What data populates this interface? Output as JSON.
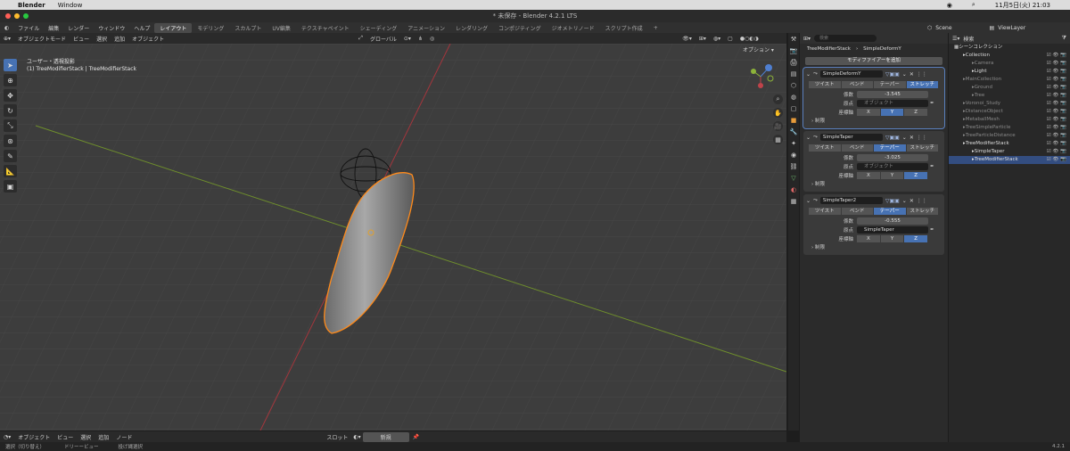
{
  "mac": {
    "apple": "",
    "app": "Blender",
    "menu": "Window",
    "datetime": "11月5日(火) 21:03"
  },
  "window": {
    "title": "* 未保存 - Blender 4.2.1 LTS"
  },
  "menubar": {
    "items": [
      "ファイル",
      "編集",
      "レンダー",
      "ウィンドウ",
      "ヘルプ"
    ],
    "workspaces": [
      "レイアウト",
      "モデリング",
      "スカルプト",
      "UV編集",
      "テクスチャペイント",
      "シェーディング",
      "アニメーション",
      "レンダリング",
      "コンポジティング",
      "ジオメトリノード",
      "スクリプト作成"
    ],
    "scene": "Scene",
    "viewlayer": "ViewLayer"
  },
  "viewport_header": {
    "mode": "オブジェクトモード",
    "items": [
      "ビュー",
      "選択",
      "追加",
      "オブジェクト"
    ],
    "orientation": "グローバル",
    "options": "オプション"
  },
  "viewport": {
    "overlay_line1": "ユーザー・透視投影",
    "overlay_line2": "(1) TreeModifierStack | TreeModifierStack"
  },
  "viewport_footer": {
    "mode": "オブジェクト",
    "items": [
      "ビュー",
      "選択",
      "追加",
      "ノード"
    ],
    "slot": "スロット",
    "new": "新規"
  },
  "statusbar": {
    "items": [
      "選択（切り替え）",
      "ドリーービュー",
      "投げ縄選択"
    ],
    "version": "4.2.1"
  },
  "properties": {
    "search_placeholder": "検索",
    "crumb_object": "TreeModifierStack",
    "crumb_modifier": "SimpleDeformY",
    "add_modifier": "モディファイアーを追加",
    "modes": [
      "ツイスト",
      "ベンド",
      "テーパー",
      "ストレッチ"
    ],
    "labels": {
      "factor": "係数",
      "origin": "原点",
      "axis": "座標軸",
      "limit": "制限",
      "object_placeholder": "オブジェクト"
    },
    "axes": [
      "X",
      "Y",
      "Z"
    ],
    "modifiers": [
      {
        "name": "SimpleDeformY",
        "mode_index": 3,
        "factor": "-3.545",
        "origin": "",
        "axis_index": 1
      },
      {
        "name": "SimpleTaper",
        "mode_index": 2,
        "factor": "-3.025",
        "origin": "",
        "axis_index": 2
      },
      {
        "name": "SimpleTaper2",
        "mode_index": 2,
        "factor": "-0.555",
        "origin": "SimpleTaper",
        "axis_index": 2
      }
    ]
  },
  "outliner": {
    "search_placeholder": "検索",
    "title": "シーンコレクション",
    "rows": [
      {
        "label": "Collection",
        "indent": 1,
        "state": "normal"
      },
      {
        "label": "Camera",
        "indent": 2,
        "state": "dim"
      },
      {
        "label": "Light",
        "indent": 2,
        "state": "normal"
      },
      {
        "label": "MainCollection",
        "indent": 1,
        "state": "dim"
      },
      {
        "label": "Ground",
        "indent": 2,
        "state": "dim"
      },
      {
        "label": "Tree",
        "indent": 2,
        "state": "dim"
      },
      {
        "label": "Voronoi_Study",
        "indent": 1,
        "state": "dim"
      },
      {
        "label": "DistanceObject",
        "indent": 1,
        "state": "dim"
      },
      {
        "label": "MetaballMesh",
        "indent": 1,
        "state": "dim"
      },
      {
        "label": "TreeSimpleParticle",
        "indent": 1,
        "state": "dim"
      },
      {
        "label": "TreeParticleDistance",
        "indent": 1,
        "state": "dim"
      },
      {
        "label": "TreeModifierStack",
        "indent": 1,
        "state": "normal"
      },
      {
        "label": "SimpleTaper",
        "indent": 2,
        "state": "normal"
      },
      {
        "label": "TreeModifierStack",
        "indent": 2,
        "state": "selected"
      }
    ]
  }
}
